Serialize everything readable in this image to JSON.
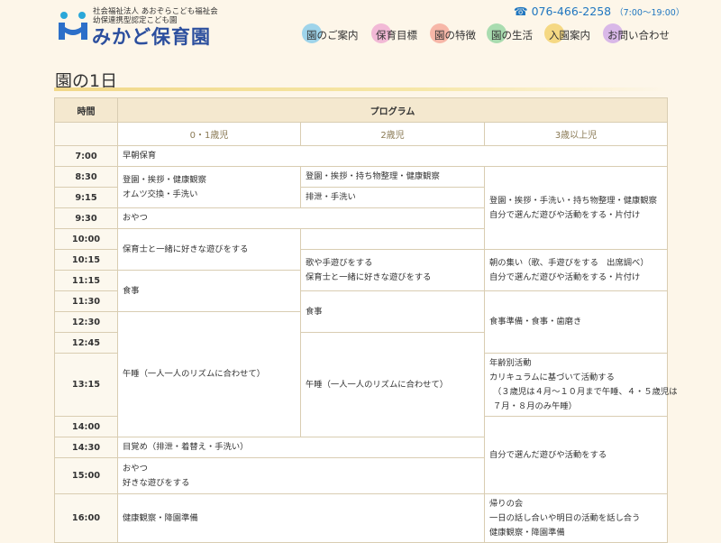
{
  "header": {
    "corp_line1": "社会福祉法人 あおぞらこども福祉会",
    "corp_line2": "幼保連携型認定こども園",
    "logo_text": "みかど保育園",
    "phone": "076-466-2258",
    "hours": "（7:00〜19:00）",
    "colors": {
      "logo": "#2c4f9e",
      "phone": "#1f76c0"
    }
  },
  "nav": [
    {
      "label": "園のご案内",
      "color": "#9fd4ea"
    },
    {
      "label": "保育目標",
      "color": "#f2b9d6"
    },
    {
      "label": "園の特徴",
      "color": "#f7b7a8"
    },
    {
      "label": "園の生活",
      "color": "#a9dcb0"
    },
    {
      "label": "入園案内",
      "color": "#f5d883"
    },
    {
      "label": "お問い合わせ",
      "color": "#d9b8e8"
    }
  ],
  "page_title": "園の1日",
  "table": {
    "head_time": "時間",
    "head_program": "プログラム",
    "age_groups": [
      "0・1歳児",
      "2歳児",
      "3歳以上児"
    ],
    "times": [
      "7:00",
      "8:30",
      "9:15",
      "9:30",
      "10:00",
      "10:15",
      "11:15",
      "11:30",
      "12:30",
      "12:45",
      "13:15",
      "14:00",
      "14:30",
      "15:00",
      "16:00"
    ],
    "c1": {
      "early": "早朝保育",
      "greet": [
        "登園・挨拶・健康観察",
        "オムツ交換・手洗い"
      ],
      "snack": "おやつ",
      "play": "保育士と一緒に好きな遊びをする",
      "meal": "食事",
      "nap": "午睡（一人一人のリズムに合わせて）",
      "wake": "目覚め（排泄・着替え・手洗い）",
      "snack2": [
        "おやつ",
        "好きな遊びをする"
      ],
      "health": "健康観察・降園準備"
    },
    "c2": {
      "greet": "登園・挨拶・持ち物整理・健康観察",
      "toilet": "排泄・手洗い",
      "play": [
        "歌や手遊びをする",
        "保育士と一緒に好きな遊びをする"
      ],
      "meal": "食事",
      "nap": "午睡（一人一人のリズムに合わせて）"
    },
    "c3": {
      "greet": [
        "登園・挨拶・手洗い・持ち物整理・健康観察",
        "自分で選んだ遊びや活動をする・片付け"
      ],
      "gather": [
        "朝の集い（歌、手遊びをする　出席調べ）",
        "自分で選んだ遊びや活動をする・片付け"
      ],
      "meal": "食事準備・食事・歯磨き",
      "age_activity": [
        "年齢別活動",
        "カリキュラムに基づいて活動する",
        "（３歳児は４月〜１０月まで午睡、４・５歳児は",
        "７月・８月のみ午睡）"
      ],
      "free": "自分で選んだ遊びや活動をする",
      "going_home": [
        "帰りの会",
        "一日の話し合いや明日の活動を話し合う",
        "健康観察・降園準備"
      ]
    }
  }
}
